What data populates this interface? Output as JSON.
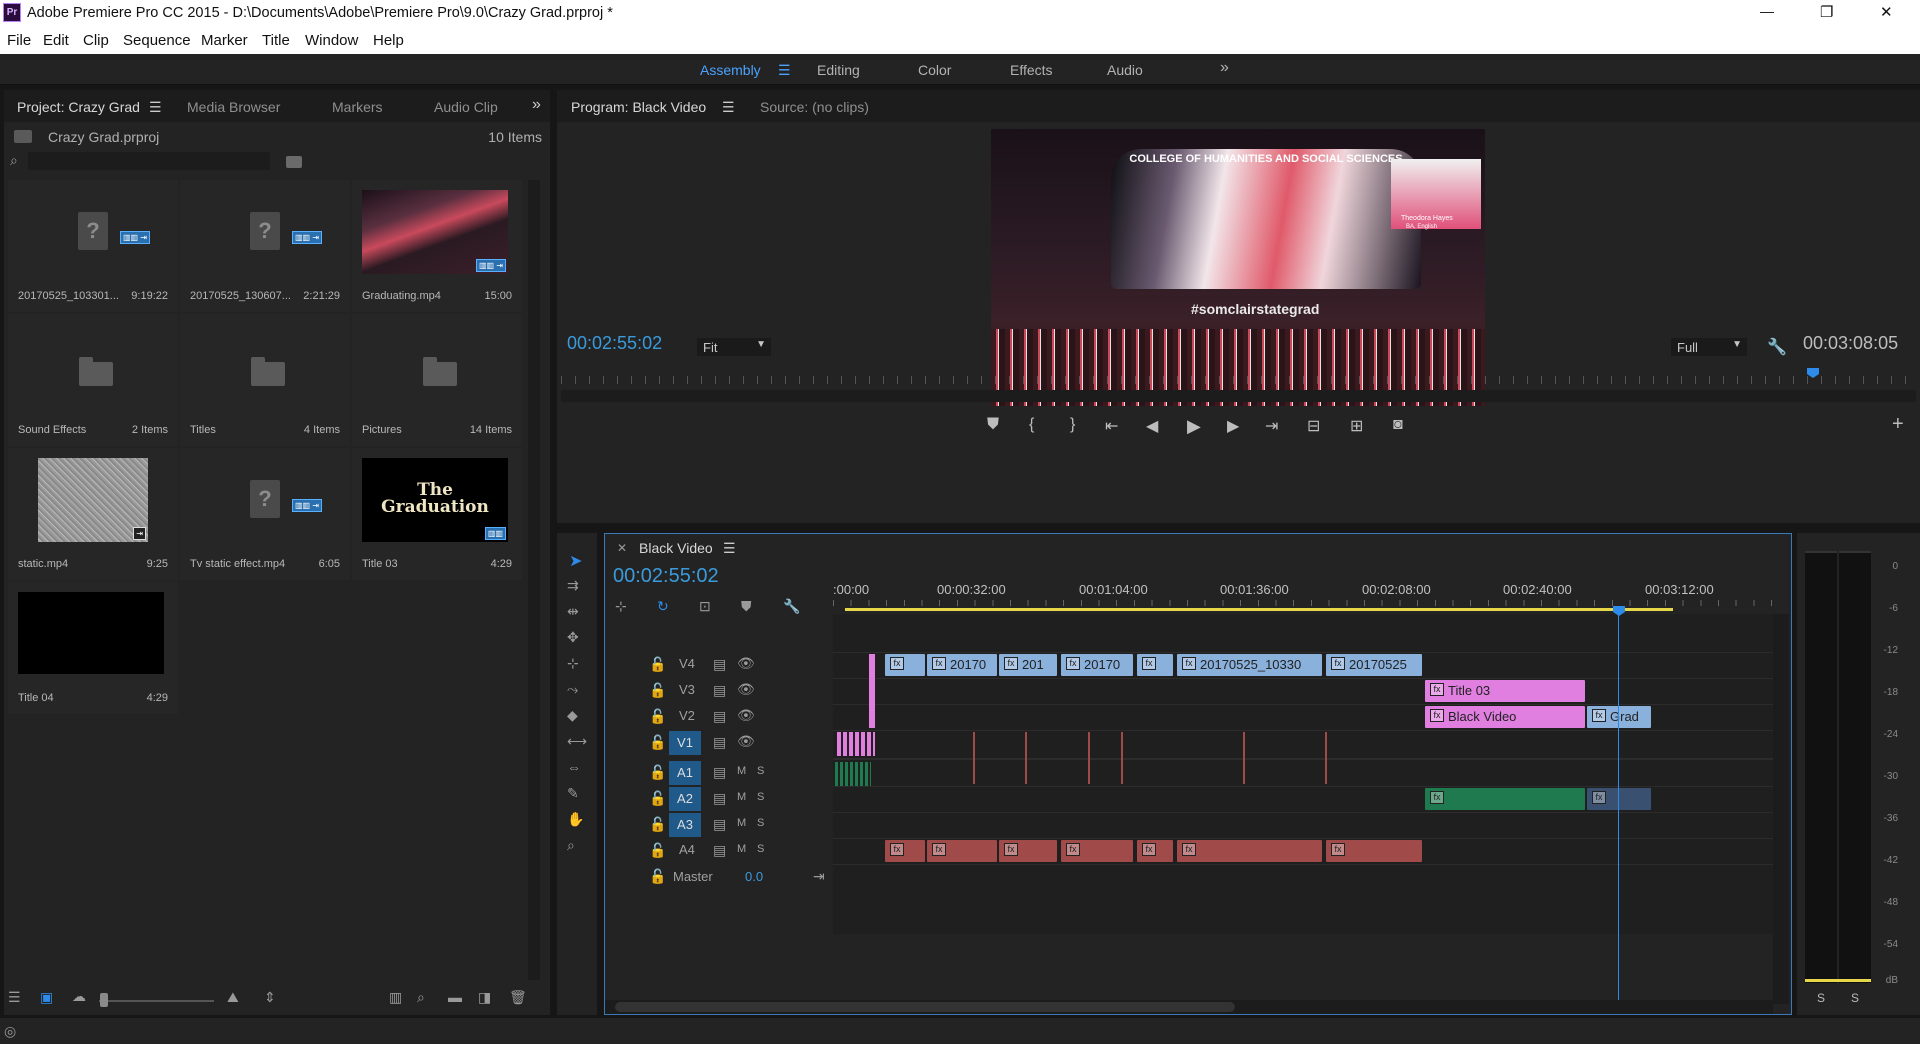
{
  "app": {
    "title": "Adobe Premiere Pro CC 2015 - D:\\Documents\\Adobe\\Premiere Pro\\9.0\\Crazy Grad.prproj *",
    "logo": "Pr"
  },
  "window_controls": {
    "minimize": "—",
    "maximize": "❐",
    "close": "✕"
  },
  "menu": [
    "File",
    "Edit",
    "Clip",
    "Sequence",
    "Marker",
    "Title",
    "Window",
    "Help"
  ],
  "workspaces": {
    "items": [
      "Assembly",
      "Editing",
      "Color",
      "Effects",
      "Audio"
    ],
    "active": "Assembly",
    "more": "»"
  },
  "project_panel": {
    "tabs": [
      "Project: Crazy Grad",
      "Media Browser",
      "Markers",
      "Audio Clip"
    ],
    "more": "»",
    "file": "Crazy Grad.prproj",
    "item_count": "10 Items",
    "search_placeholder": "",
    "items": [
      {
        "name": "20170525_103301...",
        "meta": "9:19:22",
        "kind": "unknown"
      },
      {
        "name": "20170525_130607...",
        "meta": "2:21:29",
        "kind": "unknown"
      },
      {
        "name": "Graduating.mp4",
        "meta": "15:00",
        "kind": "video"
      },
      {
        "name": "Sound Effects",
        "meta": "2 Items",
        "kind": "folder"
      },
      {
        "name": "Titles",
        "meta": "4 Items",
        "kind": "folder"
      },
      {
        "name": "Pictures",
        "meta": "14 Items",
        "kind": "folder"
      },
      {
        "name": "static.mp4",
        "meta": "9:25",
        "kind": "static"
      },
      {
        "name": "Tv static effect.mp4",
        "meta": "6:05",
        "kind": "unknown"
      },
      {
        "name": "Title 03",
        "meta": "4:29",
        "kind": "title"
      },
      {
        "name": "Title 04",
        "meta": "4:29",
        "kind": "black"
      }
    ],
    "title03_text": "The Graduation"
  },
  "program_monitor": {
    "tabs": [
      "Program: Black Video",
      "Source: (no clips)"
    ],
    "timecode_current": "00:02:55:02",
    "zoom": "Fit",
    "quality": "Full",
    "timecode_duration": "00:03:08:05",
    "playhead_fraction": 0.92,
    "video_text": {
      "banner": "COLLEGE OF HUMANITIES AND SOCIAL SCIENCES",
      "hashtag": "#somclairstategrad",
      "name": "Theodora Hayes",
      "degree": "BA, English"
    }
  },
  "timeline": {
    "sequence": "Black Video",
    "timecode": "00:02:55:02",
    "ruler": [
      ":00:00",
      "00:00:32:00",
      "00:01:04:00",
      "00:01:36:00",
      "00:02:08:00",
      "00:02:40:00",
      "00:03:12:00"
    ],
    "video_tracks": [
      "V4",
      "V3",
      "V2",
      "V1"
    ],
    "audio_tracks": [
      "A1",
      "A2",
      "A3",
      "A4"
    ],
    "audio_mute": "M",
    "audio_solo": "S",
    "master_label": "Master",
    "master_value": "0.0",
    "playhead_seconds": 175,
    "clips": {
      "v4": [
        "20170",
        "201",
        "20170",
        "20170525_10330",
        "20170525"
      ],
      "v3": "Title 03",
      "v2_a": "Black Video",
      "v2_b": "Grad",
      "fx": "fx"
    }
  },
  "audio_meter": {
    "scale": [
      "0",
      "-6",
      "-12",
      "-18",
      "-24",
      "-30",
      "-36",
      "-42",
      "-48",
      "-54",
      "dB"
    ],
    "solo": [
      "S",
      "S"
    ]
  },
  "colors": {
    "accent": "#2d8ceb",
    "timecode": "#3a9bdc",
    "clip_blue": "#8ab0dc",
    "clip_pink": "#e07fe0",
    "clip_audio_red": "#a04a4a",
    "clip_audio_green": "#1f7a4f",
    "work_area": "#e6d64a"
  }
}
